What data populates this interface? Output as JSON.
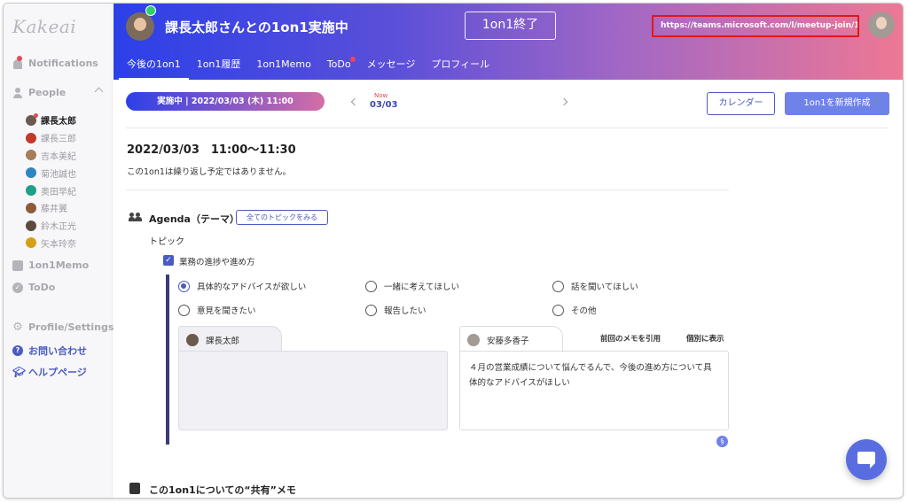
{
  "sidebar": {
    "logo": "Kakeai",
    "notifications_label": "Notifications",
    "people_label": "People",
    "people": [
      {
        "name": "課長太郎",
        "color": "#6b5a4e",
        "active": true
      },
      {
        "name": "課長三郎",
        "color": "#c0392b",
        "active": false
      },
      {
        "name": "吉本美紀",
        "color": "#a77c5a",
        "active": false
      },
      {
        "name": "菊池誠也",
        "color": "#2e86c1",
        "active": false
      },
      {
        "name": "奥田早紀",
        "color": "#1f9e8a",
        "active": false
      },
      {
        "name": "藤井翼",
        "color": "#8e5a3a",
        "active": false
      },
      {
        "name": "鈴木正光",
        "color": "#5b4a3f",
        "active": false
      },
      {
        "name": "矢本玲奈",
        "color": "#d4a017",
        "active": false
      }
    ],
    "memo_label": "1on1Memo",
    "todo_label": "ToDo",
    "settings_label": "Profile/Settings",
    "contact_label": "お問い合わせ",
    "help_label": "ヘルプページ"
  },
  "header": {
    "title": "課長太郎さんとの1on1実施中",
    "end_button": "1on1終了",
    "meeting_url": "https://teams.microsoft.com/l/meetup-join/19...",
    "tabs": [
      {
        "label": "今後の1on1",
        "active": true,
        "dot": false
      },
      {
        "label": "1on1履歴",
        "active": false,
        "dot": false
      },
      {
        "label": "1on1Memo",
        "active": false,
        "dot": false
      },
      {
        "label": "ToDo",
        "active": false,
        "dot": true
      },
      {
        "label": "メッセージ",
        "active": false,
        "dot": false
      },
      {
        "label": "プロフィール",
        "active": false,
        "dot": false
      }
    ]
  },
  "main": {
    "status_pill": "実施中 | 2022/03/03 (木) 11:00",
    "now_label": "Now",
    "current_date": "03/03",
    "calendar_button": "カレンダー",
    "new_button": "1on1を新規作成",
    "meeting_time": "2022/03/03　11:00〜11:30",
    "repeat_note": "この1on1は繰り返し予定ではありません。",
    "agenda_title": "Agenda（テーマ）",
    "all_topics_button": "全てのトピックをみる",
    "topic_label": "トピック",
    "topic_checkbox": "業務の進捗や進め方",
    "options": [
      {
        "label": "具体的なアドバイスが欲しい",
        "selected": true
      },
      {
        "label": "一緒に考えてほしい",
        "selected": false
      },
      {
        "label": "話を聞いてほしい",
        "selected": false
      },
      {
        "label": "意見を聞きたい",
        "selected": false
      },
      {
        "label": "報告したい",
        "selected": false
      },
      {
        "label": "その他",
        "selected": false
      }
    ],
    "memo_left": {
      "name": "課長太郎",
      "text": ""
    },
    "memo_right": {
      "name": "安藤多香子",
      "text": "４月の営業成績について悩んでるんで、今後の進め方について具体的なアドバイスがほしい"
    },
    "quote_prev_memo": "前回のメモを引用",
    "show_separately": "個別に表示",
    "shared_memo_title": "この1on1についての“共有”メモ"
  },
  "colors": {
    "accent": "#4a5bc2",
    "header_gradient_start": "#2c40e8",
    "header_gradient_end": "#ee7894",
    "notification_dot": "#e8465a",
    "online": "#2ecf6b",
    "url_highlight": "#e01818"
  }
}
